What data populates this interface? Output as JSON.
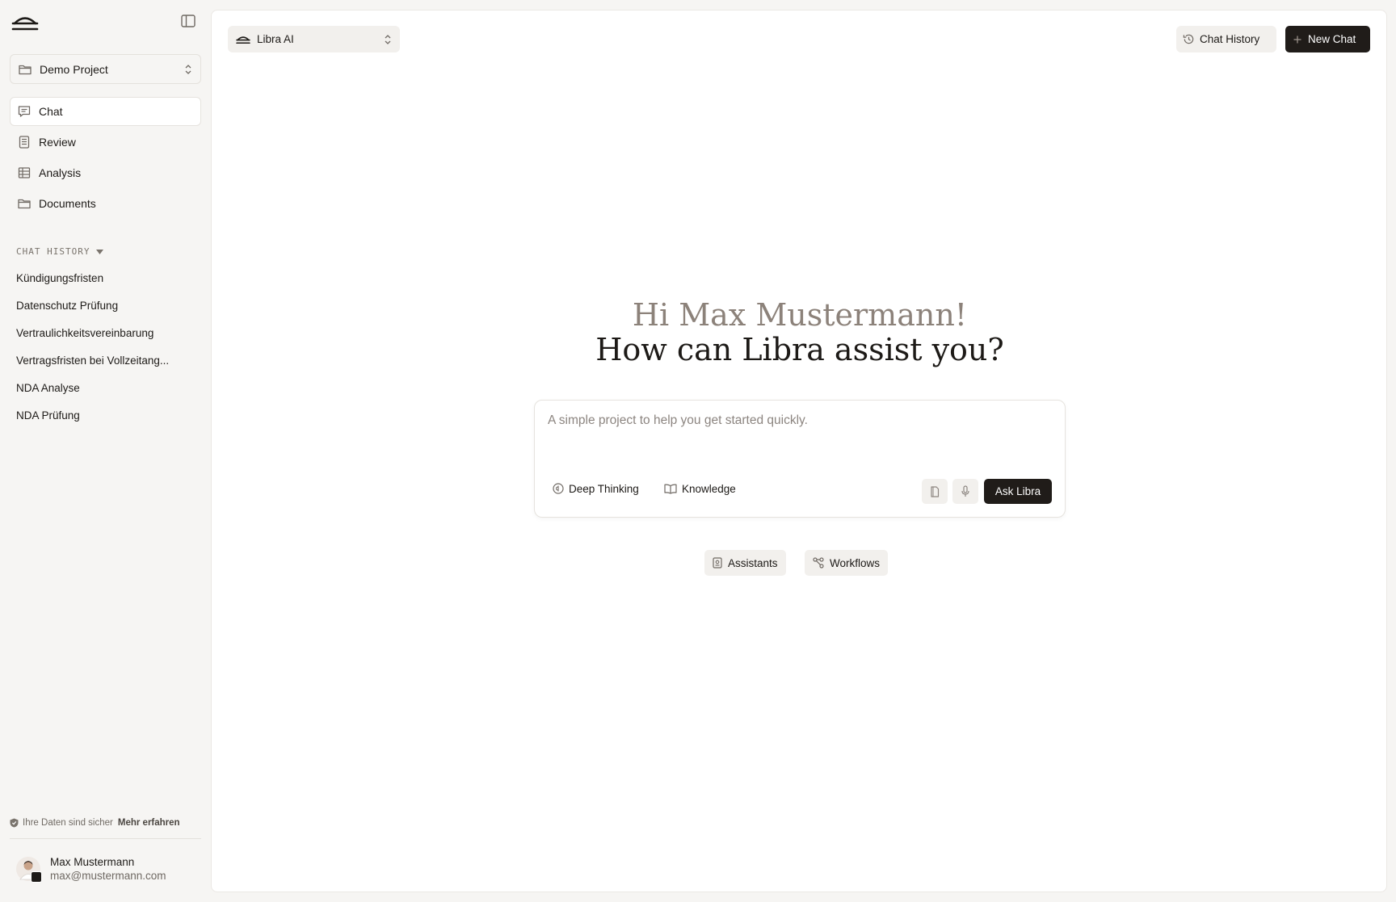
{
  "sidebar": {
    "project_select": {
      "label": "Demo Project"
    },
    "nav": [
      {
        "label": "Chat",
        "icon": "chat-icon",
        "active": true
      },
      {
        "label": "Review",
        "icon": "review-icon"
      },
      {
        "label": "Analysis",
        "icon": "table-icon"
      },
      {
        "label": "Documents",
        "icon": "folder-icon"
      }
    ],
    "history_heading": "CHAT HISTORY",
    "history": [
      "Kündigungsfristen",
      "Datenschutz Prüfung",
      "Vertraulichkeitsvereinbarung",
      "Vertragsfristen bei Vollzeitang...",
      "NDA Analyse",
      "NDA Prüfung"
    ],
    "safe_notice": {
      "text": "Ihre Daten sind sicher",
      "link": "Mehr erfahren"
    },
    "user": {
      "name": "Max Mustermann",
      "email": "max@mustermann.com"
    }
  },
  "header": {
    "model_select": {
      "label": "Libra AI"
    },
    "history_button": "Chat History",
    "new_chat_button": "New Chat"
  },
  "main": {
    "greeting_line1": "Hi Max Mustermann!",
    "greeting_line2": "How can Libra assist you?",
    "composer": {
      "placeholder": "A simple project to help you get started quickly.",
      "value": "",
      "deep_thinking": "Deep Thinking",
      "knowledge": "Knowledge",
      "ask_button": "Ask Libra"
    },
    "chips": {
      "assistants": "Assistants",
      "workflows": "Workflows"
    }
  },
  "colors": {
    "background": "#f6f5f3",
    "panel": "#ffffff",
    "primary_button": "#201c19",
    "greeting_muted": "#8c827a",
    "chip_bg": "#f2f0ed"
  }
}
